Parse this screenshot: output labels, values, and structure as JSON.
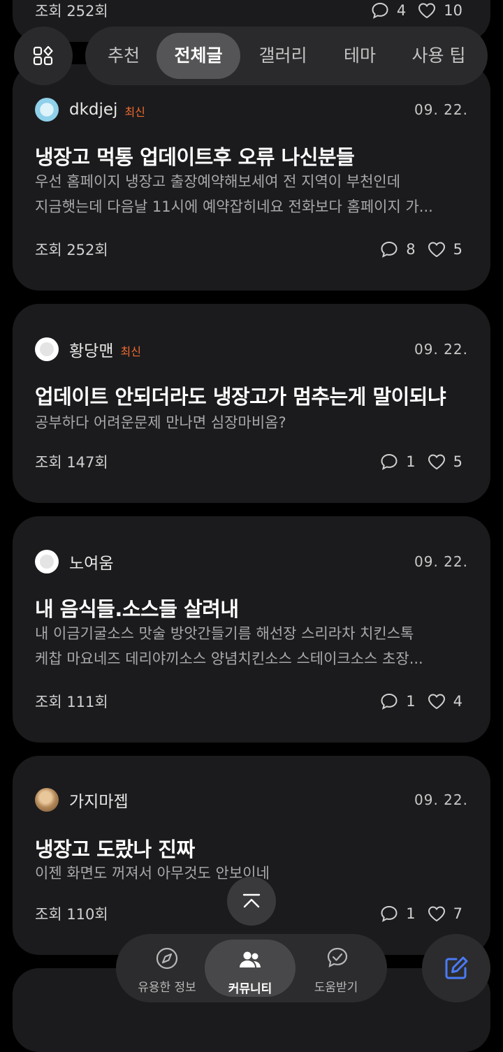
{
  "tabs": [
    "추천",
    "전체글",
    "갤러리",
    "테마",
    "사용 팁"
  ],
  "active_tab": "전체글",
  "partial_top_post": {
    "views": "조회 252회",
    "comments": "4",
    "likes": "10"
  },
  "posts": [
    {
      "author": "dkdjej",
      "badge": "최신",
      "date": "09. 22.",
      "title": "냉장고 먹통 업데이트후 오류 나신분들",
      "body": [
        "우선 홈페이지 냉장고 출장예약해보세여 전 지역이 부천인데",
        "지금햇는데 다음날 11시에 예약잡히네요 전화보다 홈페이지 가..."
      ],
      "views": "조회 252회",
      "comments": "8",
      "likes": "5"
    },
    {
      "author": "황당맨",
      "badge": "최신",
      "date": "09. 22.",
      "title": "업데이트 안되더라도 냉장고가 멈추는게 말이되냐",
      "body": [
        "공부하다 어려운문제 만나면 심장마비옴?"
      ],
      "views": "조회 147회",
      "comments": "1",
      "likes": "5"
    },
    {
      "author": "노여움",
      "badge": "",
      "date": "09. 22.",
      "title": "내 음식들.소스들 살려내",
      "body": [
        "내 이금기굴소스 맛술 방앗간들기름 해선장 스리라차 치킨스톡",
        "케찹 마요네즈 데리야끼소스 양념치킨소스 스테이크소스 초장..."
      ],
      "views": "조회 111회",
      "comments": "1",
      "likes": "4"
    },
    {
      "author": "가지마젭",
      "badge": "",
      "date": "09. 22.",
      "title": "냉장고 도랐나 진짜",
      "body": [
        "이젠 화면도 꺼져서 아무것도 안보이네"
      ],
      "views": "조회 110회",
      "comments": "1",
      "likes": "7"
    }
  ],
  "bottom_nav": [
    "유용한 정보",
    "커뮤니티",
    "도움받기"
  ],
  "active_nav": "커뮤니티",
  "icons": {
    "category": "grid-icon",
    "comment": "comment-icon",
    "like": "heart-icon",
    "scroll_top": "arrow-up-icon",
    "info": "compass-icon",
    "community": "people-icon",
    "help": "chat-check-icon",
    "write": "edit-icon"
  },
  "colors": {
    "background": "#000000",
    "card": "#1b1b1d",
    "badge": "#f26b2f",
    "accent": "#4a7bf7"
  }
}
